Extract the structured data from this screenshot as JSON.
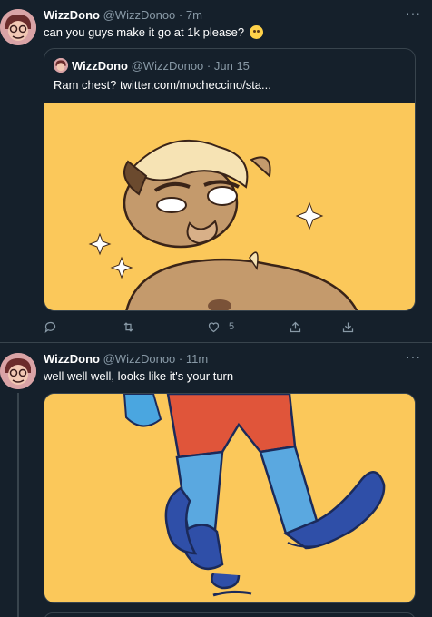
{
  "tweets": [
    {
      "name": "WizzDono",
      "handle": "@WizzDonoo",
      "separator": "·",
      "time": "7m",
      "text": "can you guys make it go at 1k please?",
      "more": "···",
      "quote": {
        "name": "WizzDono",
        "handle": "@WizzDonoo",
        "separator": "·",
        "time": "Jun 15",
        "text": "Ram chest?  twitter.com/mocheccino/sta..."
      },
      "actions": {
        "likes": "5"
      }
    },
    {
      "name": "WizzDono",
      "handle": "@WizzDonoo",
      "separator": "·",
      "time": "11m",
      "text": "well well well, looks like it's your turn",
      "more": "···"
    }
  ],
  "colors": {
    "background": "#15202b",
    "border": "#38444d",
    "secondary_text": "#8899a6",
    "image_background": "#fbc85a"
  },
  "icons": [
    "reply-icon",
    "retweet-icon",
    "like-icon",
    "share-icon",
    "analytics-icon",
    "more-icon",
    "emoji-icon"
  ]
}
